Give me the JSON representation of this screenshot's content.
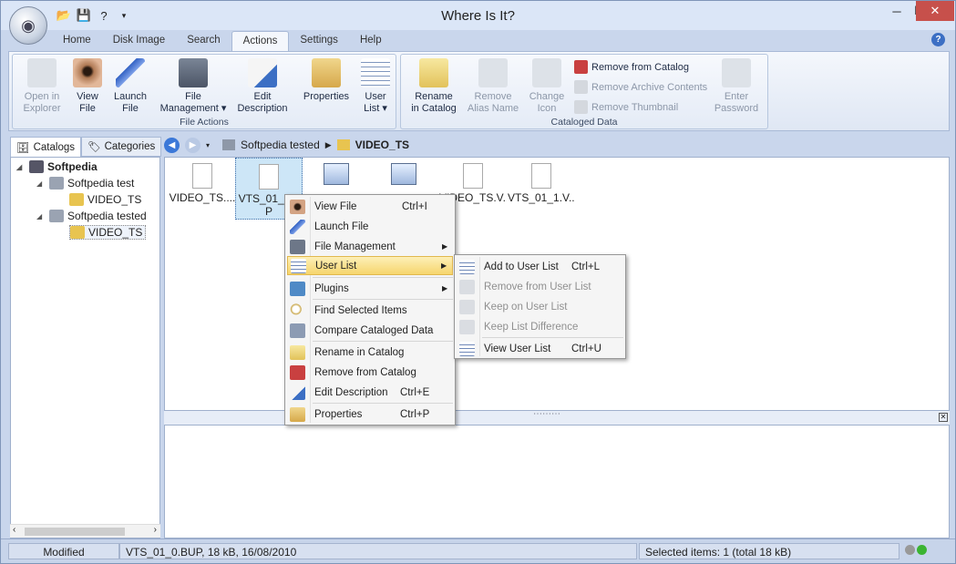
{
  "window": {
    "title": "Where Is It?"
  },
  "tabs": [
    "Home",
    "Disk Image",
    "Search",
    "Actions",
    "Settings",
    "Help"
  ],
  "ribbon": {
    "file_actions": {
      "caption": "File Actions",
      "buttons": [
        {
          "label": "Open in\nExplorer",
          "disabled": true
        },
        {
          "label": "View\nFile",
          "disabled": false
        },
        {
          "label": "Launch\nFile",
          "disabled": false
        },
        {
          "label": "File\nManagement ▾",
          "disabled": false
        },
        {
          "label": "Edit\nDescription",
          "disabled": false
        },
        {
          "label": "Properties",
          "disabled": false
        },
        {
          "label": "User\nList ▾",
          "disabled": false
        }
      ]
    },
    "cataloged_data": {
      "caption": "Cataloged Data",
      "buttons": [
        {
          "label": "Rename\nin Catalog",
          "disabled": false
        },
        {
          "label": "Remove\nAlias Name",
          "disabled": true
        },
        {
          "label": "Change\nIcon",
          "disabled": true
        },
        {
          "label": "Enter\nPassword",
          "disabled": true
        }
      ],
      "small": [
        {
          "label": "Remove from Catalog",
          "disabled": false
        },
        {
          "label": "Remove Archive Contents",
          "disabled": true
        },
        {
          "label": "Remove Thumbnail",
          "disabled": true
        }
      ]
    }
  },
  "left_tabs": [
    "Catalogs",
    "Categories"
  ],
  "tree": [
    "Softpedia",
    "Softpedia test",
    "VIDEO_TS",
    "Softpedia tested",
    "VIDEO_TS"
  ],
  "breadcrumb": [
    "Softpedia tested",
    "VIDEO_TS"
  ],
  "files": [
    {
      "name": "VIDEO_TS....",
      "type": "doc"
    },
    {
      "name": "VTS_01_0...",
      "sub": "P",
      "type": "doc"
    },
    {
      "name": "",
      "type": "img"
    },
    {
      "name": "",
      "type": "img"
    },
    {
      "name": "VIDEO_TS.V...",
      "type": "doc"
    },
    {
      "name": "VTS_01_1.V...",
      "type": "doc"
    }
  ],
  "context_menu": {
    "items": [
      {
        "label": "View File",
        "shortcut": "Ctrl+I"
      },
      {
        "label": "Launch File"
      },
      {
        "label": "File Management",
        "submenu": true
      },
      {
        "label": "User List",
        "submenu": true,
        "highlight": true
      },
      {
        "label": "Plugins",
        "submenu": true
      },
      {
        "label": "Find Selected Items"
      },
      {
        "label": "Compare Cataloged Data"
      },
      {
        "label": "Rename in Catalog"
      },
      {
        "label": "Remove from Catalog"
      },
      {
        "label": "Edit Description",
        "shortcut": "Ctrl+E"
      },
      {
        "label": "Properties",
        "shortcut": "Ctrl+P"
      }
    ]
  },
  "submenu": {
    "items": [
      {
        "label": "Add to User List",
        "shortcut": "Ctrl+L",
        "disabled": false
      },
      {
        "label": "Remove from User List",
        "disabled": true
      },
      {
        "label": "Keep on User List",
        "disabled": true
      },
      {
        "label": "Keep List Difference",
        "disabled": true
      },
      {
        "label": "View User List",
        "shortcut": "Ctrl+U",
        "disabled": false
      }
    ]
  },
  "status": {
    "mode": "Modified",
    "file": "VTS_01_0.BUP, 18 kB, 16/08/2010",
    "selection": "Selected items: 1 (total 18 kB)"
  }
}
